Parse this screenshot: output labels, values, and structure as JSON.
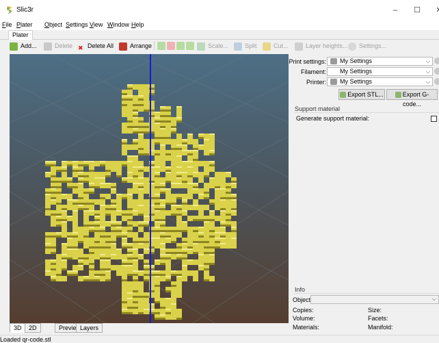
{
  "window": {
    "title": "Slic3r",
    "min": "–",
    "max": "☐",
    "close": "✕"
  },
  "menubar": [
    {
      "u": "F",
      "rest": "ile"
    },
    {
      "u": "P",
      "rest": "later"
    },
    {
      "u": "O",
      "rest": "bject"
    },
    {
      "u": "S",
      "rest": "ettings"
    },
    {
      "u": "V",
      "rest": "iew"
    },
    {
      "u": "W",
      "rest": "indow"
    },
    {
      "u": "H",
      "rest": "elp"
    }
  ],
  "tabs": {
    "plater": "Plater"
  },
  "toolbar": {
    "add": "Add...",
    "delete": "Delete",
    "delete_all": "Delete All",
    "arrange": "Arrange",
    "scale": "Scale...",
    "split": "Split",
    "cut": "Cut...",
    "layer_heights": "Layer heights...",
    "settings": "Settings..."
  },
  "settings": {
    "print_label": "Print settings:",
    "print_value": "My Settings",
    "filament_label": "Filament:",
    "filament_value": "My Settings",
    "printer_label": "Printer:",
    "printer_value": "My Settings",
    "export_stl": "Export STL...",
    "export_gcode": "Export G-code..."
  },
  "support": {
    "title": "Support material",
    "generate_label": "Generate support material:",
    "generate_checked": false
  },
  "info": {
    "title": "Info",
    "object_label": "Object:",
    "copies": "Copies:",
    "size": "Size:",
    "volume": "Volume:",
    "facets": "Facets:",
    "materials": "Materials:",
    "manifold": "Manifold:"
  },
  "view_tabs": [
    "3D",
    "2D",
    "Preview",
    "Layers"
  ],
  "status": {
    "text": "Loaded qr-code.stl"
  },
  "colors": {
    "model": "#d9d24a",
    "axis": "#1a1ad6",
    "bg_top": "#4d6f86",
    "bg_bottom": "#553e30"
  }
}
